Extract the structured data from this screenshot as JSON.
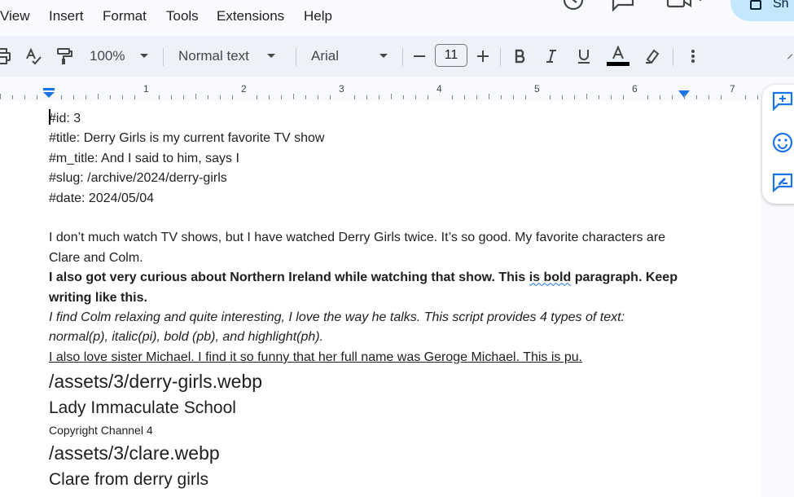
{
  "menu": {
    "items": [
      "View",
      "Insert",
      "Format",
      "Tools",
      "Extensions",
      "Help"
    ],
    "share_label": "Sh"
  },
  "toolbar": {
    "zoom": "100%",
    "style": "Normal text",
    "font": "Arial",
    "font_size": "11",
    "text_color_swatch": "#000000"
  },
  "ruler": {
    "numbers": [
      "1",
      "2",
      "3",
      "4",
      "5",
      "6",
      "7"
    ]
  },
  "doc": {
    "lines": {
      "id": "#id: 3",
      "title": "#title: Derry Girls is my current favorite TV show",
      "m_title": "#m_title: And I said to him, says I",
      "slug": "#slug: /archive/2024/derry-girls",
      "date": "#date: 2024/05/04"
    },
    "para_normal": "I don’t much watch TV shows, but I have watched Derry Girls twice. It’s so good. My favorite characters are Clare and Colm.",
    "para_bold_a": "I also got very curious about Northern Ireland while watching that show. This ",
    "para_bold_squiggle": "is bold",
    "para_bold_b": " paragraph. Keep writing like this.",
    "para_italic": "I find Colm relaxing and quite interesting, I love the way he talks. This script provides 4 types of text: normal(p), italic(pi), bold (pb), and highlight(ph).",
    "para_underline": "I also love sister Michael. I find it so funny that her full name was Geroge Michael. This is pu.",
    "image1_path": "/assets/3/derry-girls.webp",
    "image1_caption": "Lady Immaculate School",
    "image1_credit": "Copyright Channel 4",
    "image2_path": "/assets/3/clare.webp",
    "image2_caption": "Clare from derry girls"
  }
}
